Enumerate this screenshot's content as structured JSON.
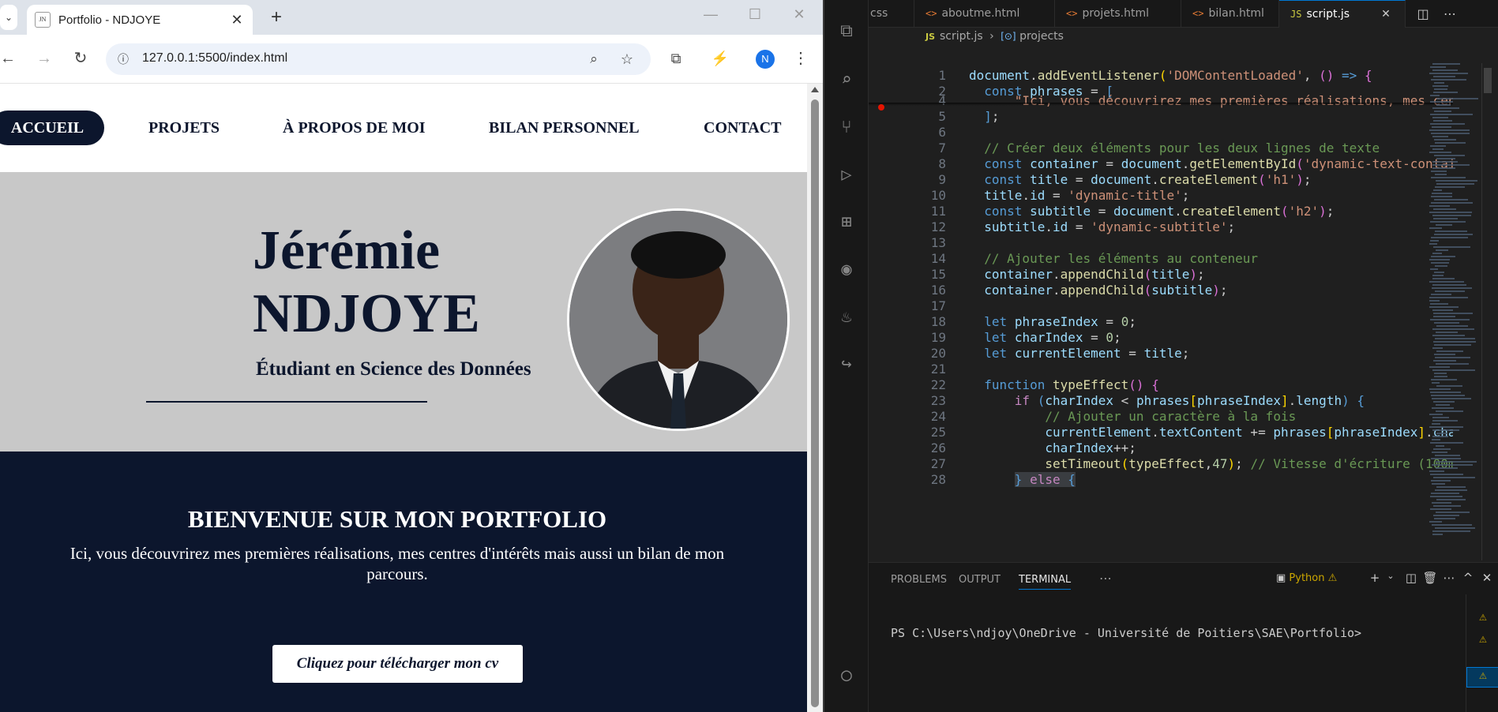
{
  "browser": {
    "tab_title": "Portfolio - NDJOYE",
    "favicon_text": "JN",
    "url": "127.0.0.1:5500/index.html",
    "profile_initial": "N"
  },
  "site": {
    "nav": [
      "ACCUEIL",
      "PROJETS",
      "À PROPOS DE MOI",
      "BILAN PERSONNEL",
      "CONTACT"
    ],
    "hero_name_line1": "Jérémie",
    "hero_name_line2": "NDJOYE",
    "hero_subtitle": "Étudiant en Science des Données",
    "welcome_title": "BIENVENUE SUR MON PORTFOLIO",
    "welcome_text": "Ici, vous découvrirez mes premières réalisations, mes centres d'intérêts mais aussi un bilan de mon parcours.",
    "cv_button": "Cliquez pour télécharger mon cv"
  },
  "vscode": {
    "tabs": [
      {
        "icon": "",
        "label": "css"
      },
      {
        "icon": "<>",
        "label": "aboutme.html"
      },
      {
        "icon": "<>",
        "label": "projets.html"
      },
      {
        "icon": "<>",
        "label": "bilan.html"
      },
      {
        "icon": "JS",
        "label": "script.js"
      }
    ],
    "breadcrumb_file": "script.js",
    "breadcrumb_symbol": "projects",
    "line_numbers": [
      "1",
      "2",
      "4",
      "5",
      "6",
      "7",
      "8",
      "9",
      "10",
      "11",
      "12",
      "13",
      "14",
      "15",
      "16",
      "17",
      "18",
      "19",
      "20",
      "21",
      "22",
      "23",
      "24",
      "25",
      "26",
      "27",
      "28"
    ],
    "panel_tabs": [
      "PROBLEMS",
      "OUTPUT",
      "TERMINAL"
    ],
    "terminal_profile": "Python",
    "terminal_prompt": "PS C:\\Users\\ndjoy\\OneDrive - Université de Poitiers\\SAE\\Portfolio>"
  },
  "colors": {
    "navy": "#0c162d",
    "hero_bg": "#c8c8c8",
    "vscode_bg": "#1f1f1f",
    "accent": "#0078d4"
  }
}
